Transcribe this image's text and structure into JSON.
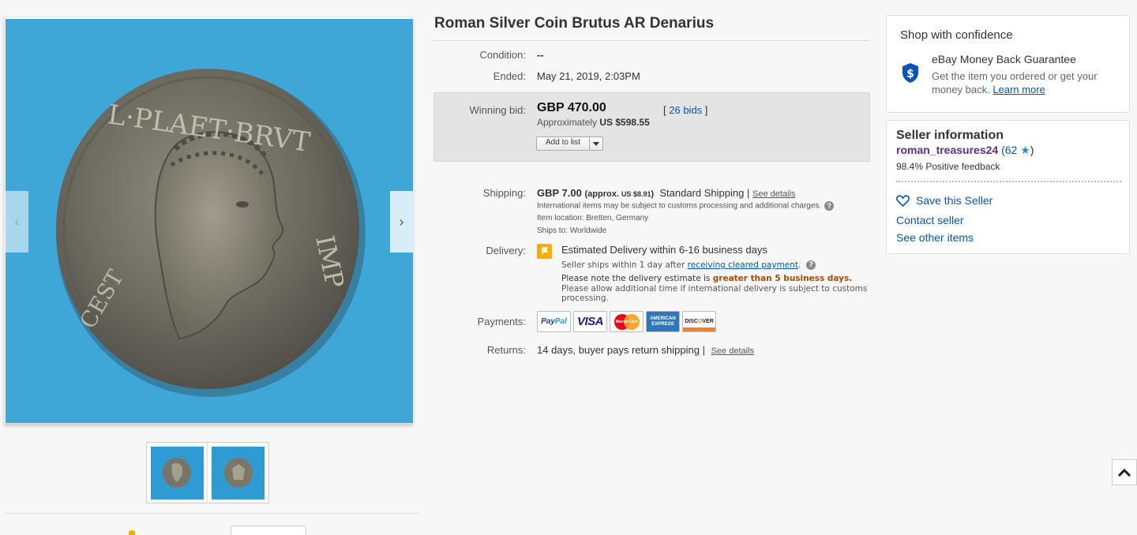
{
  "listing": {
    "title": "Roman Silver Coin Brutus AR Denarius"
  },
  "details": {
    "condition_label": "Condition:",
    "condition_value": "--",
    "ended_label": "Ended:",
    "ended_value": "May 21, 2019, 2:03PM",
    "winning_bid_label": "Winning bid:",
    "winning_bid_value": "GBP 470.00",
    "approx_prefix": "Approximately",
    "approx_value": "US $598.55",
    "bids_open": "[",
    "bids_link": "26 bids",
    "bids_close": "]",
    "add_to_list": "Add to list"
  },
  "shipping": {
    "label": "Shipping:",
    "price": "GBP 7.00",
    "approx_open": "(approx.",
    "approx_value": "US $8.91",
    "approx_close": ")",
    "method": "Standard Shipping |",
    "see_details": "See details",
    "intl_note": "International items may be subject to customs processing and additional charges.",
    "item_location": "Item location:  Bretten, Germany",
    "ships_to": "Ships to:  Worldwide"
  },
  "delivery": {
    "label": "Delivery:",
    "estimate": "Estimated Delivery within 6-16 business days",
    "ships_within_pre": "Seller ships within 1 day after",
    "ships_within_link": "receiving cleared payment",
    "ships_within_post": ".",
    "note_pre": "Please note the delivery estimate is",
    "note_highlight": "greater than 5 business days.",
    "note_extra": "Please allow additional time if international delivery is subject to customs processing."
  },
  "payments": {
    "label": "Payments:",
    "methods": [
      "PayPal",
      "VISA",
      "MasterCard",
      "AMERICAN EXPRESS",
      "DISCOVER"
    ],
    "paypal_a": "Pay",
    "paypal_b": "Pal",
    "mc_text": "MasterCard",
    "amex_line1": "AMERICAN",
    "amex_line2": "EXPRESS",
    "disc_a": "DISC",
    "disc_o": "O",
    "disc_b": "VER"
  },
  "returns": {
    "label": "Returns:",
    "value": "14 days, buyer pays return shipping |",
    "see_details": "See details"
  },
  "confidence": {
    "heading": "Shop with confidence",
    "guarantee_title": "eBay Money Back Guarantee",
    "guarantee_text": "Get the item you ordered or get your money back.",
    "learn_more": "Learn more",
    "icon": "shield-dollar-icon"
  },
  "seller": {
    "heading": "Seller information",
    "username": "roman_treasures24",
    "score_open": "(62",
    "score_close": ")",
    "feedback": "98.4% Positive feedback",
    "save": "Save this Seller",
    "contact": "Contact seller",
    "other_items": "See other items"
  },
  "gallery": {
    "coin_legend_top": "L·PLAET·BRVT",
    "coin_legend_right": "IMP",
    "coin_legend_left": "CEST"
  },
  "colors": {
    "image_bg": "#3ea7d8",
    "link": "#0654ba",
    "seller": "#5a2d91",
    "highlight": "#a64b00",
    "delivery_icon": "#f5af02"
  }
}
